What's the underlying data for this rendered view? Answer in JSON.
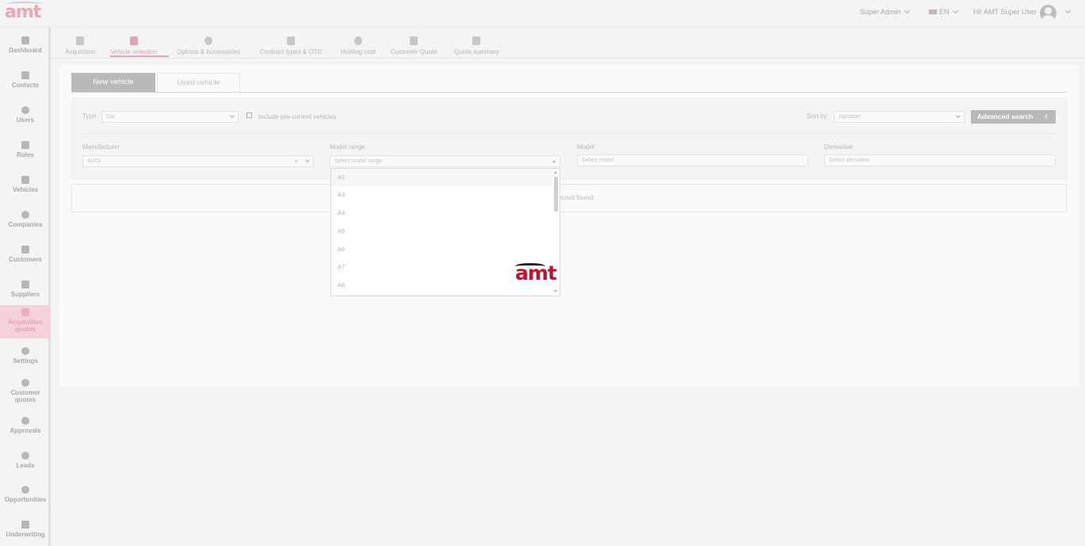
{
  "app": {
    "logo_text": "amt"
  },
  "topbar": {
    "role": "Super Admin",
    "language": "EN",
    "greeting": "Hi! AMT Super User"
  },
  "sidebar": {
    "items": [
      {
        "label": "Dashboard",
        "icon": "dashboard-icon"
      },
      {
        "label": "Contacts",
        "icon": "contacts-icon"
      },
      {
        "label": "Users",
        "icon": "user-icon"
      },
      {
        "label": "Roles",
        "icon": "roles-icon"
      },
      {
        "label": "Vehicles",
        "icon": "car-icon"
      },
      {
        "label": "Companies",
        "icon": "company-icon"
      },
      {
        "label": "Customers",
        "icon": "customers-icon"
      },
      {
        "label": "Suppliers",
        "icon": "suppliers-icon"
      },
      {
        "label": "Acquisition quotes",
        "icon": "document-icon",
        "active": true
      },
      {
        "label": "Settings",
        "icon": "gear-icon"
      },
      {
        "label": "Customer quotes",
        "icon": "customer-quote-icon"
      },
      {
        "label": "Approvals",
        "icon": "check-circle-icon"
      },
      {
        "label": "Leads",
        "icon": "leads-icon"
      },
      {
        "label": "Opportunities",
        "icon": "lightbulb-icon"
      },
      {
        "label": "Underwriting",
        "icon": "underwriting-icon"
      }
    ]
  },
  "steps": [
    {
      "label": "Acquisition"
    },
    {
      "label": "Vehicle selection",
      "active": true
    },
    {
      "label": "Options & Accessories"
    },
    {
      "label": "Contract types & OTR"
    },
    {
      "label": "Holding cost"
    },
    {
      "label": "Customer Quote"
    },
    {
      "label": "Quote summary"
    }
  ],
  "tabs": {
    "new_vehicle": "New vehicle",
    "used_vehicle": "Used vehicle"
  },
  "filters": {
    "type_label": "Type",
    "type_value": "Car",
    "include_label": "Include pre-current vehicles",
    "sort_label": "Sort by",
    "sort_value": "Alphabet",
    "advanced_search": "Advanced search",
    "manufacturer_label": "Manufacturer",
    "manufacturer_value": "AUDI",
    "model_range_label": "Model range",
    "model_range_placeholder": "Select model range",
    "model_label": "Model",
    "model_placeholder": "Select model",
    "derivative_label": "Derivative",
    "derivative_placeholder": "Select derivative"
  },
  "results": {
    "empty_text": "No record found"
  },
  "model_range_options": [
    "A1",
    "A3",
    "A4",
    "A5",
    "A6",
    "A7",
    "A8"
  ],
  "loader": {
    "logo_text": "amt"
  }
}
